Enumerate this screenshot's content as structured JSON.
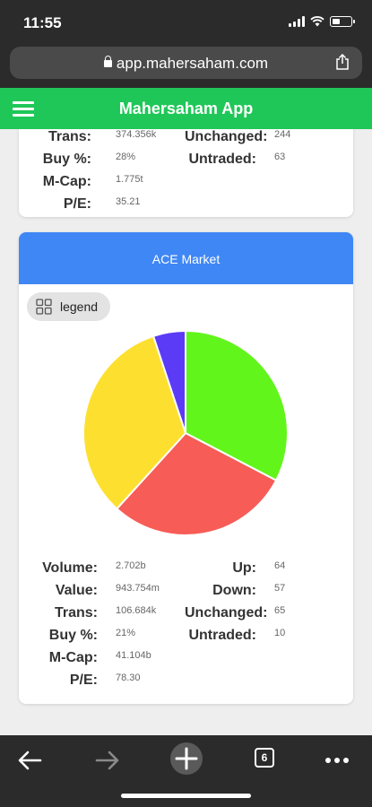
{
  "status": {
    "time": "11:55"
  },
  "browser": {
    "url": "app.mahersaham.com",
    "tabs_count": "6"
  },
  "header": {
    "title": "Mahersaham App"
  },
  "prev_card": {
    "rows_left": [
      {
        "label": "Trans:",
        "value": "374.356k"
      },
      {
        "label": "Buy %:",
        "value": "28%"
      },
      {
        "label": "M-Cap:",
        "value": "1.775t"
      },
      {
        "label": "P/E:",
        "value": "35.21"
      }
    ],
    "rows_right": [
      {
        "label": "Unchanged:",
        "value": "244"
      },
      {
        "label": "Untraded:",
        "value": "63"
      }
    ]
  },
  "ace_card": {
    "title": "ACE Market",
    "legend_label": "legend",
    "rows_left": [
      {
        "label": "Volume:",
        "value": "2.702b"
      },
      {
        "label": "Value:",
        "value": "943.754m"
      },
      {
        "label": "Trans:",
        "value": "106.684k"
      },
      {
        "label": "Buy %:",
        "value": "21%"
      },
      {
        "label": "M-Cap:",
        "value": "41.104b"
      },
      {
        "label": "P/E:",
        "value": "78.30"
      }
    ],
    "rows_right": [
      {
        "label": "Up:",
        "value": "64"
      },
      {
        "label": "Down:",
        "value": "57"
      },
      {
        "label": "Unchanged:",
        "value": "65"
      },
      {
        "label": "Untraded:",
        "value": "10"
      }
    ]
  },
  "chart_data": {
    "type": "pie",
    "slices": [
      {
        "value": 64,
        "color": "#62f51c"
      },
      {
        "value": 57,
        "color": "#f75c57"
      },
      {
        "value": 65,
        "color": "#fde02f"
      },
      {
        "value": 10,
        "color": "#5b3bf6"
      }
    ]
  }
}
